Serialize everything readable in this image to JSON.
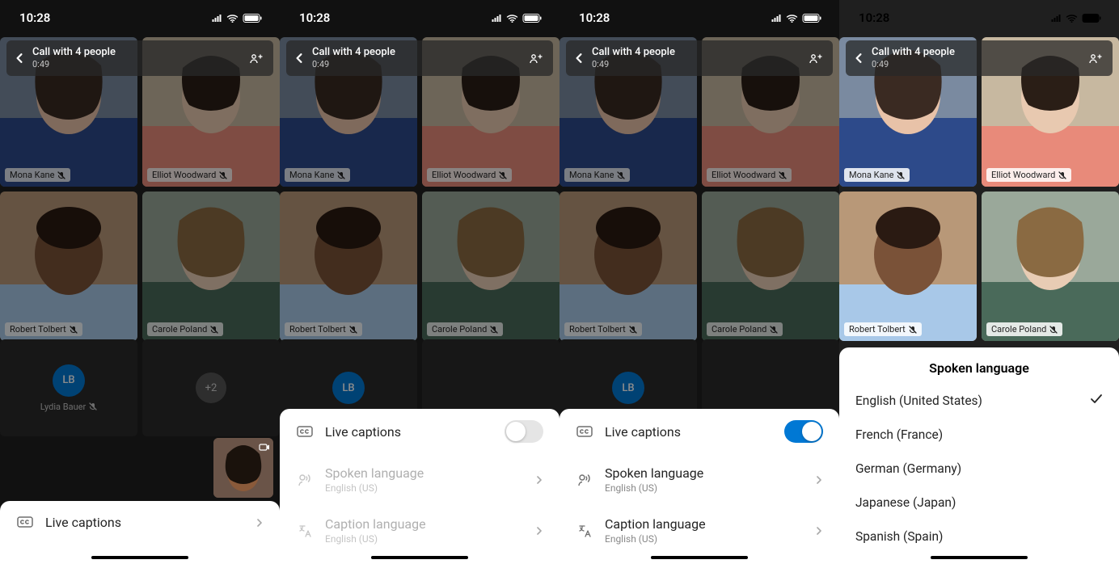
{
  "status": {
    "time": "10:28"
  },
  "call": {
    "title": "Call with 4 people",
    "duration": "0:49"
  },
  "participants": [
    {
      "name": "Mona Kane"
    },
    {
      "name": "Elliot Woodward"
    },
    {
      "name": "Robert Tolbert"
    },
    {
      "name": "Carole Poland"
    }
  ],
  "extra": {
    "initials": "LB",
    "name": "Lydia Bauer",
    "overflow": "+2"
  },
  "rows": {
    "live_captions": "Live captions",
    "spoken": "Spoken language",
    "spoken_sub": "English (US)",
    "caption_lang": "Caption language",
    "caption_sub": "English (US)"
  },
  "language_sheet": {
    "title": "Spoken language",
    "options": [
      {
        "label": "English (United States)",
        "selected": true
      },
      {
        "label": "French (France)",
        "selected": false
      },
      {
        "label": "German (Germany)",
        "selected": false
      },
      {
        "label": "Japanese (Japan)",
        "selected": false
      },
      {
        "label": "Spanish (Spain)",
        "selected": false
      }
    ]
  },
  "colors": {
    "accent": "#0078d4"
  }
}
